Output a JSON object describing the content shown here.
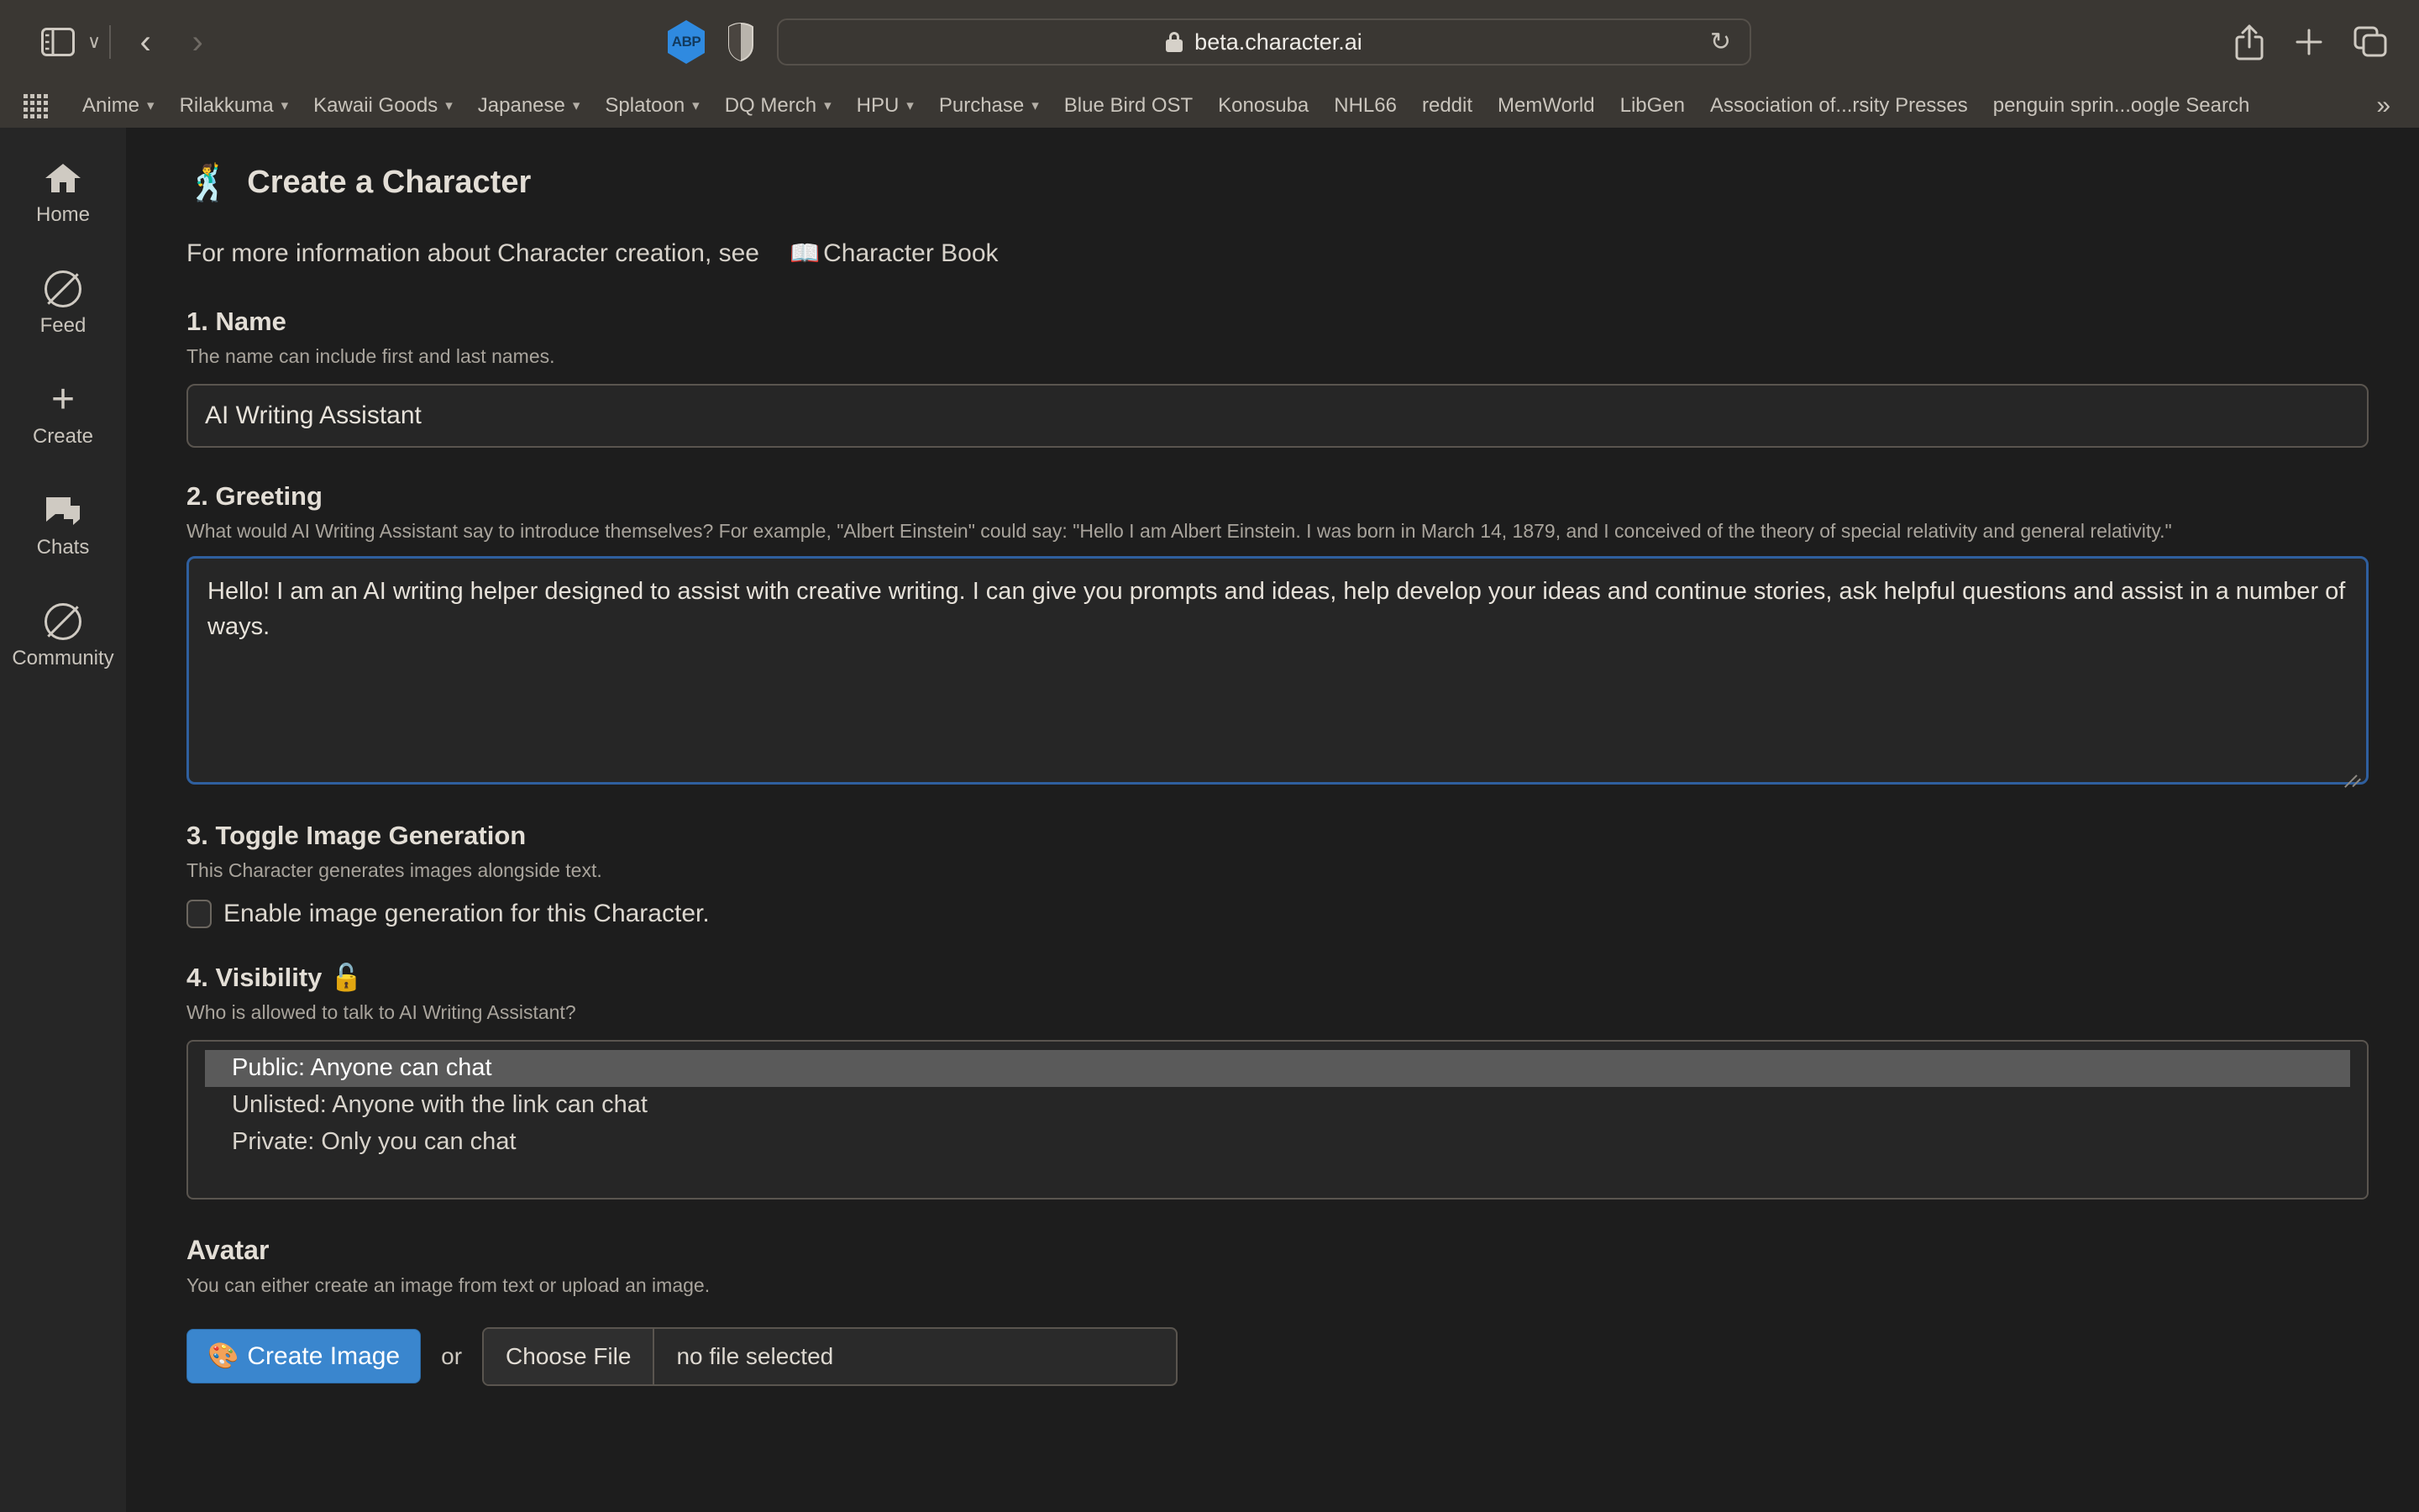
{
  "browser": {
    "url": "beta.character.ai",
    "lock_icon": "lock-icon",
    "sidebar_toggle_icon": "sidebar-toggle-icon",
    "back_label": "‹",
    "forward_label": "›",
    "chevron_label": "∨",
    "abp_label": "ABP",
    "shield_icon": "shield-icon",
    "reload_label": "↻",
    "share_icon": "share-icon",
    "new_tab_icon": "plus-icon",
    "tabs_icon": "tab-overview-icon",
    "bookmarks_more": "»",
    "bookmarks": [
      {
        "label": "Anime",
        "caret": true
      },
      {
        "label": "Rilakkuma",
        "caret": true
      },
      {
        "label": "Kawaii Goods",
        "caret": true
      },
      {
        "label": "Japanese",
        "caret": true
      },
      {
        "label": "Splatoon",
        "caret": true
      },
      {
        "label": "DQ Merch",
        "caret": true
      },
      {
        "label": "HPU",
        "caret": true
      },
      {
        "label": "Purchase",
        "caret": true
      },
      {
        "label": "Blue Bird OST",
        "caret": false
      },
      {
        "label": "Konosuba",
        "caret": false
      },
      {
        "label": "NHL66",
        "caret": false
      },
      {
        "label": "reddit",
        "caret": false
      },
      {
        "label": "MemWorld",
        "caret": false
      },
      {
        "label": "LibGen",
        "caret": false
      },
      {
        "label": "Association of...rsity Presses",
        "caret": false
      },
      {
        "label": "penguin sprin...oogle Search",
        "caret": false
      }
    ]
  },
  "sidebar": {
    "items": [
      {
        "label": "Home",
        "icon": "home-icon"
      },
      {
        "label": "Feed",
        "icon": "blocked-image-icon"
      },
      {
        "label": "Create",
        "icon": "plus-icon"
      },
      {
        "label": "Chats",
        "icon": "chat-bubbles-icon"
      },
      {
        "label": "Community",
        "icon": "blocked-image-icon"
      }
    ]
  },
  "page": {
    "title": "Create a Character",
    "title_emoji": "🕺",
    "info_prefix": "For more information about Character creation, see",
    "info_link": "Character Book",
    "info_link_emoji": "📖"
  },
  "name_section": {
    "title": "1. Name",
    "subtitle": "The name can include first and last names.",
    "value": "AI Writing Assistant",
    "placeholder": ""
  },
  "greeting_section": {
    "title": "2. Greeting",
    "subtitle": "What would AI Writing Assistant say to introduce themselves? For example, \"Albert Einstein\" could say: \"Hello I am Albert Einstein. I was born in March 14, 1879, and I conceived of the theory of special relativity and general relativity.\"",
    "value": "Hello! I am an AI writing helper designed to assist with creative writing. I can give you prompts and ideas, help develop your ideas and continue stories, ask helpful questions and assist in a number of ways.",
    "placeholder": ""
  },
  "image_gen_section": {
    "title": "3. Toggle Image Generation",
    "subtitle": "This Character generates images alongside text.",
    "checkbox_label": "Enable image generation for this Character.",
    "checked": false
  },
  "visibility_section": {
    "title": "4. Visibility",
    "title_emoji": "🔓",
    "subtitle": "Who is allowed to talk to AI Writing Assistant?",
    "options": [
      {
        "label": "Public: Anyone can chat",
        "selected": true
      },
      {
        "label": "Unlisted: Anyone with the link can chat",
        "selected": false
      },
      {
        "label": "Private: Only you can chat",
        "selected": false
      }
    ]
  },
  "avatar_section": {
    "title": "Avatar",
    "subtitle": "You can either create an image from text or upload an image.",
    "create_button": "Create Image",
    "create_button_emoji": "🎨",
    "or_label": "or",
    "choose_file_label": "Choose File",
    "file_name": "no file selected"
  },
  "colors": {
    "accent_blue": "#3a86ce",
    "focus_border": "#2f5f9e",
    "chrome_bg": "#3a3733",
    "app_bg": "#1d1d1d",
    "sidebar_bg": "#262626"
  }
}
